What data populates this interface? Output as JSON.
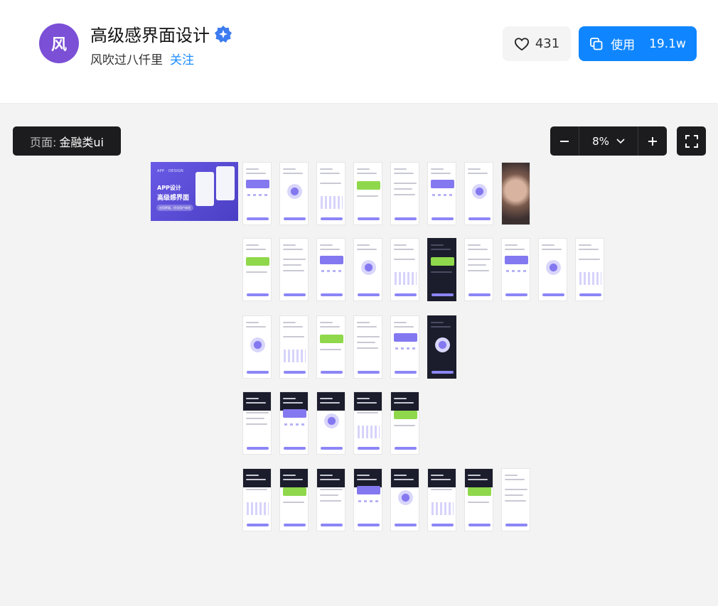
{
  "header": {
    "avatar_text": "风",
    "title": "高级感界面设计",
    "verified_icon": "verified-badge-icon",
    "author": "风吹过八仟里",
    "follow_label": "关注",
    "like_count": "431",
    "use_label": "使用",
    "use_count": "19.1w",
    "accent_color": "#0f86ff"
  },
  "canvas": {
    "page_label": "页面:",
    "page_name": "金融类ui",
    "zoom_level": "8%",
    "zoom_out_icon": "minus-icon",
    "zoom_in_icon": "plus-icon",
    "fullscreen_icon": "fullscreen-icon"
  },
  "banner": {
    "small_text": "APP · DESIGN",
    "line1": "APP设计",
    "line2": "高级感界面",
    "tag": "应用界面，优化用户体验"
  },
  "thumb_rows": [
    {
      "count": 8,
      "dark": [],
      "photo": [
        7
      ]
    },
    {
      "count": 10,
      "dark": [
        5
      ],
      "photo": []
    },
    {
      "count": 6,
      "dark": [
        5
      ],
      "photo": []
    },
    {
      "count": 5,
      "dark": [],
      "photo": []
    },
    {
      "count": 8,
      "dark": [],
      "photo": []
    }
  ]
}
